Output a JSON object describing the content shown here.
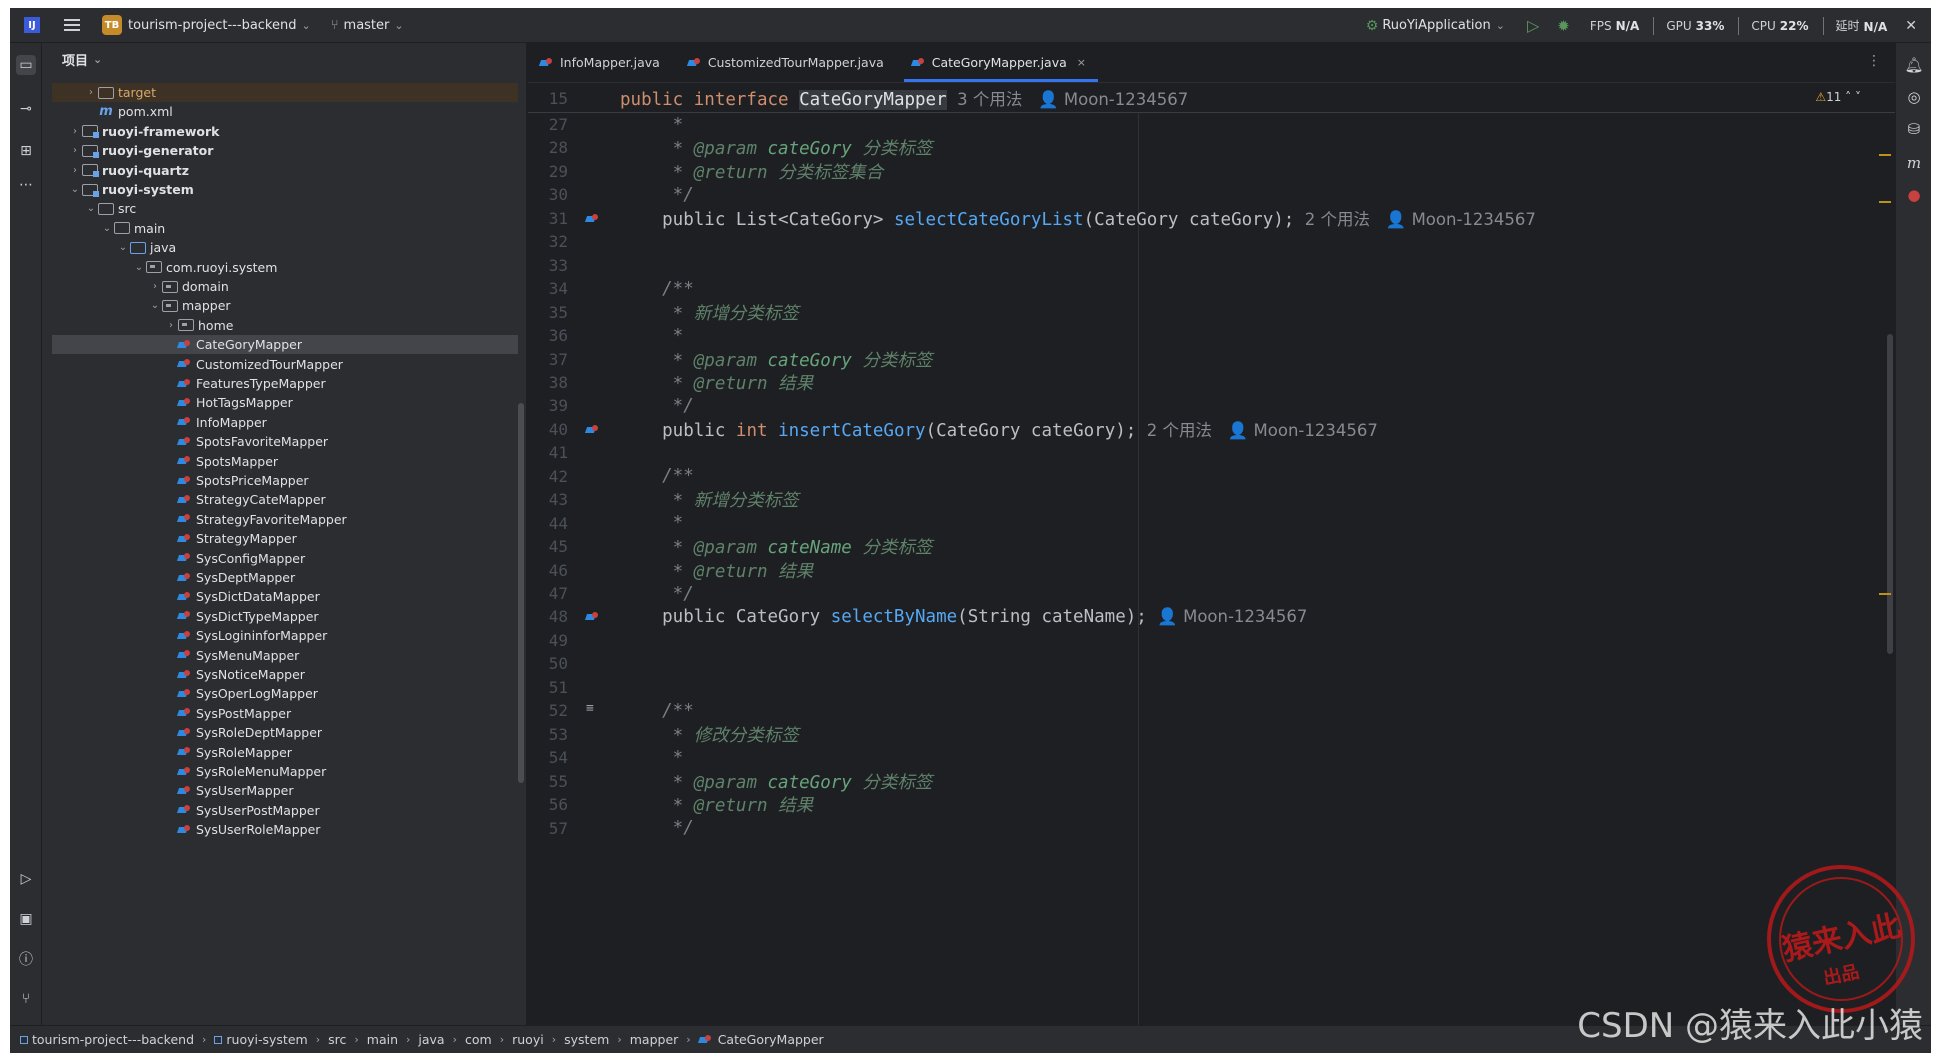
{
  "titlebar": {
    "app_logo": "IJ",
    "project_badge": "TB",
    "project_name": "tourism-project---backend",
    "branch": "master",
    "run_config": "RuoYiApplication",
    "fps_label": "FPS",
    "fps_value": "N/A",
    "gpu_label": "GPU",
    "gpu_value": "33%",
    "cpu_label": "CPU",
    "cpu_value": "22%",
    "latency_label": "延时",
    "latency_value": "N/A"
  },
  "project_panel": {
    "title": "项目",
    "items": [
      {
        "label": "target",
        "kind": "folder-excluded",
        "indent": 2,
        "arrow": "›"
      },
      {
        "label": "pom.xml",
        "kind": "maven",
        "indent": 2,
        "arrow": ""
      },
      {
        "label": "ruoyi-framework",
        "kind": "module",
        "indent": 1,
        "arrow": "›",
        "bold": true
      },
      {
        "label": "ruoyi-generator",
        "kind": "module",
        "indent": 1,
        "arrow": "›",
        "bold": true
      },
      {
        "label": "ruoyi-quartz",
        "kind": "module",
        "indent": 1,
        "arrow": "›",
        "bold": true
      },
      {
        "label": "ruoyi-system",
        "kind": "module",
        "indent": 1,
        "arrow": "⌄",
        "bold": true
      },
      {
        "label": "src",
        "kind": "folder",
        "indent": 2,
        "arrow": "⌄"
      },
      {
        "label": "main",
        "kind": "folder",
        "indent": 3,
        "arrow": "⌄"
      },
      {
        "label": "java",
        "kind": "folder-blue",
        "indent": 4,
        "arrow": "⌄"
      },
      {
        "label": "com.ruoyi.system",
        "kind": "package",
        "indent": 5,
        "arrow": "⌄"
      },
      {
        "label": "domain",
        "kind": "package",
        "indent": 6,
        "arrow": "›"
      },
      {
        "label": "mapper",
        "kind": "package",
        "indent": 6,
        "arrow": "⌄"
      },
      {
        "label": "home",
        "kind": "package",
        "indent": 7,
        "arrow": "›"
      },
      {
        "label": "CateGoryMapper",
        "kind": "mapper",
        "indent": 7,
        "arrow": "",
        "selected": true
      },
      {
        "label": "CustomizedTourMapper",
        "kind": "mapper",
        "indent": 7,
        "arrow": ""
      },
      {
        "label": "FeaturesTypeMapper",
        "kind": "mapper",
        "indent": 7,
        "arrow": ""
      },
      {
        "label": "HotTagsMapper",
        "kind": "mapper",
        "indent": 7,
        "arrow": ""
      },
      {
        "label": "InfoMapper",
        "kind": "mapper",
        "indent": 7,
        "arrow": ""
      },
      {
        "label": "SpotsFavoriteMapper",
        "kind": "mapper",
        "indent": 7,
        "arrow": ""
      },
      {
        "label": "SpotsMapper",
        "kind": "mapper",
        "indent": 7,
        "arrow": ""
      },
      {
        "label": "SpotsPriceMapper",
        "kind": "mapper",
        "indent": 7,
        "arrow": ""
      },
      {
        "label": "StrategyCateMapper",
        "kind": "mapper",
        "indent": 7,
        "arrow": ""
      },
      {
        "label": "StrategyFavoriteMapper",
        "kind": "mapper",
        "indent": 7,
        "arrow": ""
      },
      {
        "label": "StrategyMapper",
        "kind": "mapper",
        "indent": 7,
        "arrow": ""
      },
      {
        "label": "SysConfigMapper",
        "kind": "mapper",
        "indent": 7,
        "arrow": ""
      },
      {
        "label": "SysDeptMapper",
        "kind": "mapper",
        "indent": 7,
        "arrow": ""
      },
      {
        "label": "SysDictDataMapper",
        "kind": "mapper",
        "indent": 7,
        "arrow": ""
      },
      {
        "label": "SysDictTypeMapper",
        "kind": "mapper",
        "indent": 7,
        "arrow": ""
      },
      {
        "label": "SysLogininforMapper",
        "kind": "mapper",
        "indent": 7,
        "arrow": ""
      },
      {
        "label": "SysMenuMapper",
        "kind": "mapper",
        "indent": 7,
        "arrow": ""
      },
      {
        "label": "SysNoticeMapper",
        "kind": "mapper",
        "indent": 7,
        "arrow": ""
      },
      {
        "label": "SysOperLogMapper",
        "kind": "mapper",
        "indent": 7,
        "arrow": ""
      },
      {
        "label": "SysPostMapper",
        "kind": "mapper",
        "indent": 7,
        "arrow": ""
      },
      {
        "label": "SysRoleDeptMapper",
        "kind": "mapper",
        "indent": 7,
        "arrow": ""
      },
      {
        "label": "SysRoleMapper",
        "kind": "mapper",
        "indent": 7,
        "arrow": ""
      },
      {
        "label": "SysRoleMenuMapper",
        "kind": "mapper",
        "indent": 7,
        "arrow": ""
      },
      {
        "label": "SysUserMapper",
        "kind": "mapper",
        "indent": 7,
        "arrow": ""
      },
      {
        "label": "SysUserPostMapper",
        "kind": "mapper",
        "indent": 7,
        "arrow": ""
      },
      {
        "label": "SysUserRoleMapper",
        "kind": "mapper",
        "indent": 7,
        "arrow": ""
      }
    ]
  },
  "tabs": [
    {
      "label": "InfoMapper.java",
      "active": false
    },
    {
      "label": "CustomizedTourMapper.java",
      "active": false
    },
    {
      "label": "CateGoryMapper.java",
      "active": true,
      "close": "×"
    }
  ],
  "editor": {
    "sticky_line_no": "15",
    "sticky_code": [
      {
        "t": "public interface ",
        "c": "kw"
      },
      {
        "t": "CateGoryMapper",
        "c": "hilite"
      },
      {
        "t": "  3 个用法   ",
        "c": "hint"
      },
      {
        "t": "👤 Moon-1234567",
        "c": "hint"
      }
    ],
    "warnings": "11",
    "lines": [
      {
        "n": "27",
        "code": [
          {
            "t": "     *",
            "c": "cm"
          }
        ]
      },
      {
        "n": "28",
        "code": [
          {
            "t": "     * ",
            "c": "cm"
          },
          {
            "t": "@param",
            "c": "tag"
          },
          {
            "t": " cateGory ",
            "c": "doc"
          },
          {
            "t": "分类标签",
            "c": "docz"
          }
        ]
      },
      {
        "n": "29",
        "code": [
          {
            "t": "     * ",
            "c": "cm"
          },
          {
            "t": "@return",
            "c": "tag"
          },
          {
            "t": " 分类标签集合",
            "c": "docz"
          }
        ]
      },
      {
        "n": "30",
        "code": [
          {
            "t": "     */",
            "c": "cm"
          }
        ]
      },
      {
        "n": "31",
        "gutter": "mapper",
        "code": [
          {
            "t": "    public List<CateGory> ",
            "c": "txt"
          },
          {
            "t": "selectCateGoryList",
            "c": "fn"
          },
          {
            "t": "(CateGory cateGory);",
            "c": "txt"
          },
          {
            "t": "  2 个用法   👤 Moon-1234567",
            "c": "hint"
          }
        ]
      },
      {
        "n": "32",
        "code": []
      },
      {
        "n": "33",
        "code": []
      },
      {
        "n": "34",
        "code": [
          {
            "t": "    /**",
            "c": "cm"
          }
        ]
      },
      {
        "n": "35",
        "code": [
          {
            "t": "     * ",
            "c": "cm"
          },
          {
            "t": "新增分类标签",
            "c": "docz"
          }
        ]
      },
      {
        "n": "36",
        "code": [
          {
            "t": "     *",
            "c": "cm"
          }
        ]
      },
      {
        "n": "37",
        "code": [
          {
            "t": "     * ",
            "c": "cm"
          },
          {
            "t": "@param",
            "c": "tag"
          },
          {
            "t": " cateGory ",
            "c": "doc"
          },
          {
            "t": "分类标签",
            "c": "docz"
          }
        ]
      },
      {
        "n": "38",
        "code": [
          {
            "t": "     * ",
            "c": "cm"
          },
          {
            "t": "@return",
            "c": "tag"
          },
          {
            "t": " 结果",
            "c": "docz"
          }
        ]
      },
      {
        "n": "39",
        "code": [
          {
            "t": "     */",
            "c": "cm"
          }
        ]
      },
      {
        "n": "40",
        "gutter": "mapper",
        "code": [
          {
            "t": "    public ",
            "c": "txt"
          },
          {
            "t": "int ",
            "c": "kw"
          },
          {
            "t": "insertCateGory",
            "c": "fn"
          },
          {
            "t": "(CateGory cateGory);",
            "c": "txt"
          },
          {
            "t": "  2 个用法   👤 Moon-1234567",
            "c": "hint"
          }
        ]
      },
      {
        "n": "41",
        "code": []
      },
      {
        "n": "42",
        "code": [
          {
            "t": "    /**",
            "c": "cm"
          }
        ]
      },
      {
        "n": "43",
        "code": [
          {
            "t": "     * ",
            "c": "cm"
          },
          {
            "t": "新增分类标签",
            "c": "docz"
          }
        ]
      },
      {
        "n": "44",
        "code": [
          {
            "t": "     *",
            "c": "cm"
          }
        ]
      },
      {
        "n": "45",
        "code": [
          {
            "t": "     * ",
            "c": "cm"
          },
          {
            "t": "@param",
            "c": "tag"
          },
          {
            "t": " cateName ",
            "c": "doc"
          },
          {
            "t": "分类标签",
            "c": "docz"
          }
        ]
      },
      {
        "n": "46",
        "code": [
          {
            "t": "     * ",
            "c": "cm"
          },
          {
            "t": "@return",
            "c": "tag"
          },
          {
            "t": " 结果",
            "c": "docz"
          }
        ]
      },
      {
        "n": "47",
        "code": [
          {
            "t": "     */",
            "c": "cm"
          }
        ]
      },
      {
        "n": "48",
        "gutter": "mapper",
        "code": [
          {
            "t": "    public CateGory ",
            "c": "txt"
          },
          {
            "t": "selectByName",
            "c": "fn"
          },
          {
            "t": "(String cateName);",
            "c": "txt"
          },
          {
            "t": "  👤 Moon-1234567",
            "c": "hint"
          }
        ]
      },
      {
        "n": "49",
        "code": []
      },
      {
        "n": "50",
        "code": []
      },
      {
        "n": "51",
        "code": []
      },
      {
        "n": "52",
        "gutter": "doc",
        "code": [
          {
            "t": "    /**",
            "c": "cm"
          }
        ]
      },
      {
        "n": "53",
        "code": [
          {
            "t": "     * ",
            "c": "cm"
          },
          {
            "t": "修改分类标签",
            "c": "docz"
          }
        ]
      },
      {
        "n": "54",
        "code": [
          {
            "t": "     *",
            "c": "cm"
          }
        ]
      },
      {
        "n": "55",
        "code": [
          {
            "t": "     * ",
            "c": "cm"
          },
          {
            "t": "@param",
            "c": "tag"
          },
          {
            "t": " cateGory ",
            "c": "doc"
          },
          {
            "t": "分类标签",
            "c": "docz"
          }
        ]
      },
      {
        "n": "56",
        "code": [
          {
            "t": "     * ",
            "c": "cm"
          },
          {
            "t": "@return",
            "c": "tag"
          },
          {
            "t": " 结果",
            "c": "docz"
          }
        ]
      },
      {
        "n": "57",
        "code": [
          {
            "t": "     */",
            "c": "cm"
          }
        ]
      }
    ]
  },
  "statusbar": {
    "breadcrumbs": [
      "tourism-project---backend",
      "ruoyi-system",
      "src",
      "main",
      "java",
      "com",
      "ruoyi",
      "system",
      "mapper",
      "CateGoryMapper"
    ]
  },
  "watermark": {
    "csdn": "CSDN @猿来入此小猿",
    "seal_main": "猿来入此",
    "seal_sub": "出品"
  },
  "icons": {
    "left_strip": [
      "folder-icon",
      "commit-icon",
      "structure-icon",
      "more-icon",
      "run-icon",
      "terminal-icon",
      "problems-icon",
      "git-icon"
    ],
    "right_strip": [
      "notifications-icon",
      "ai-assistant-icon",
      "database-icon",
      "maven-icon",
      "mybatis-icon"
    ]
  }
}
